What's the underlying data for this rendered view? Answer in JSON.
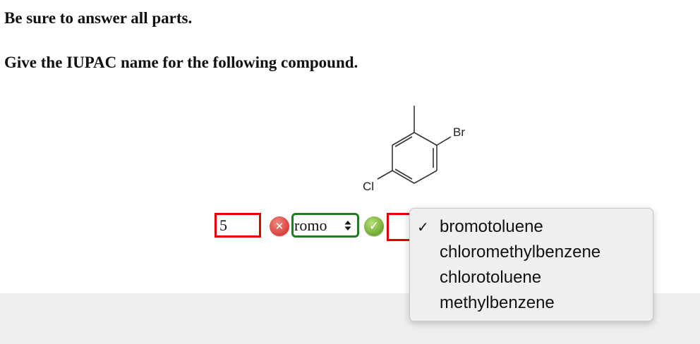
{
  "instructions": {
    "line1": "Be sure to answer all parts.",
    "line2": "Give the IUPAC name for the following compound."
  },
  "molecule": {
    "labels": {
      "br": "Br",
      "cl": "Cl"
    }
  },
  "answer": {
    "number_value": "5",
    "wrong_icon": "x-icon",
    "correct_icon": "check-icon",
    "halogen_select_value": "romo",
    "parent_select_value": ""
  },
  "dropdown": {
    "selected_mark": "✓",
    "options": [
      {
        "label": "bromotoluene",
        "selected": true
      },
      {
        "label": "chloromethylbenzene",
        "selected": false
      },
      {
        "label": "chlorotoluene",
        "selected": false
      },
      {
        "label": "methylbenzene",
        "selected": false
      }
    ]
  },
  "colors": {
    "error": "#e00000",
    "success": "#1e7d1e",
    "dropdown_bg": "#efefef"
  }
}
